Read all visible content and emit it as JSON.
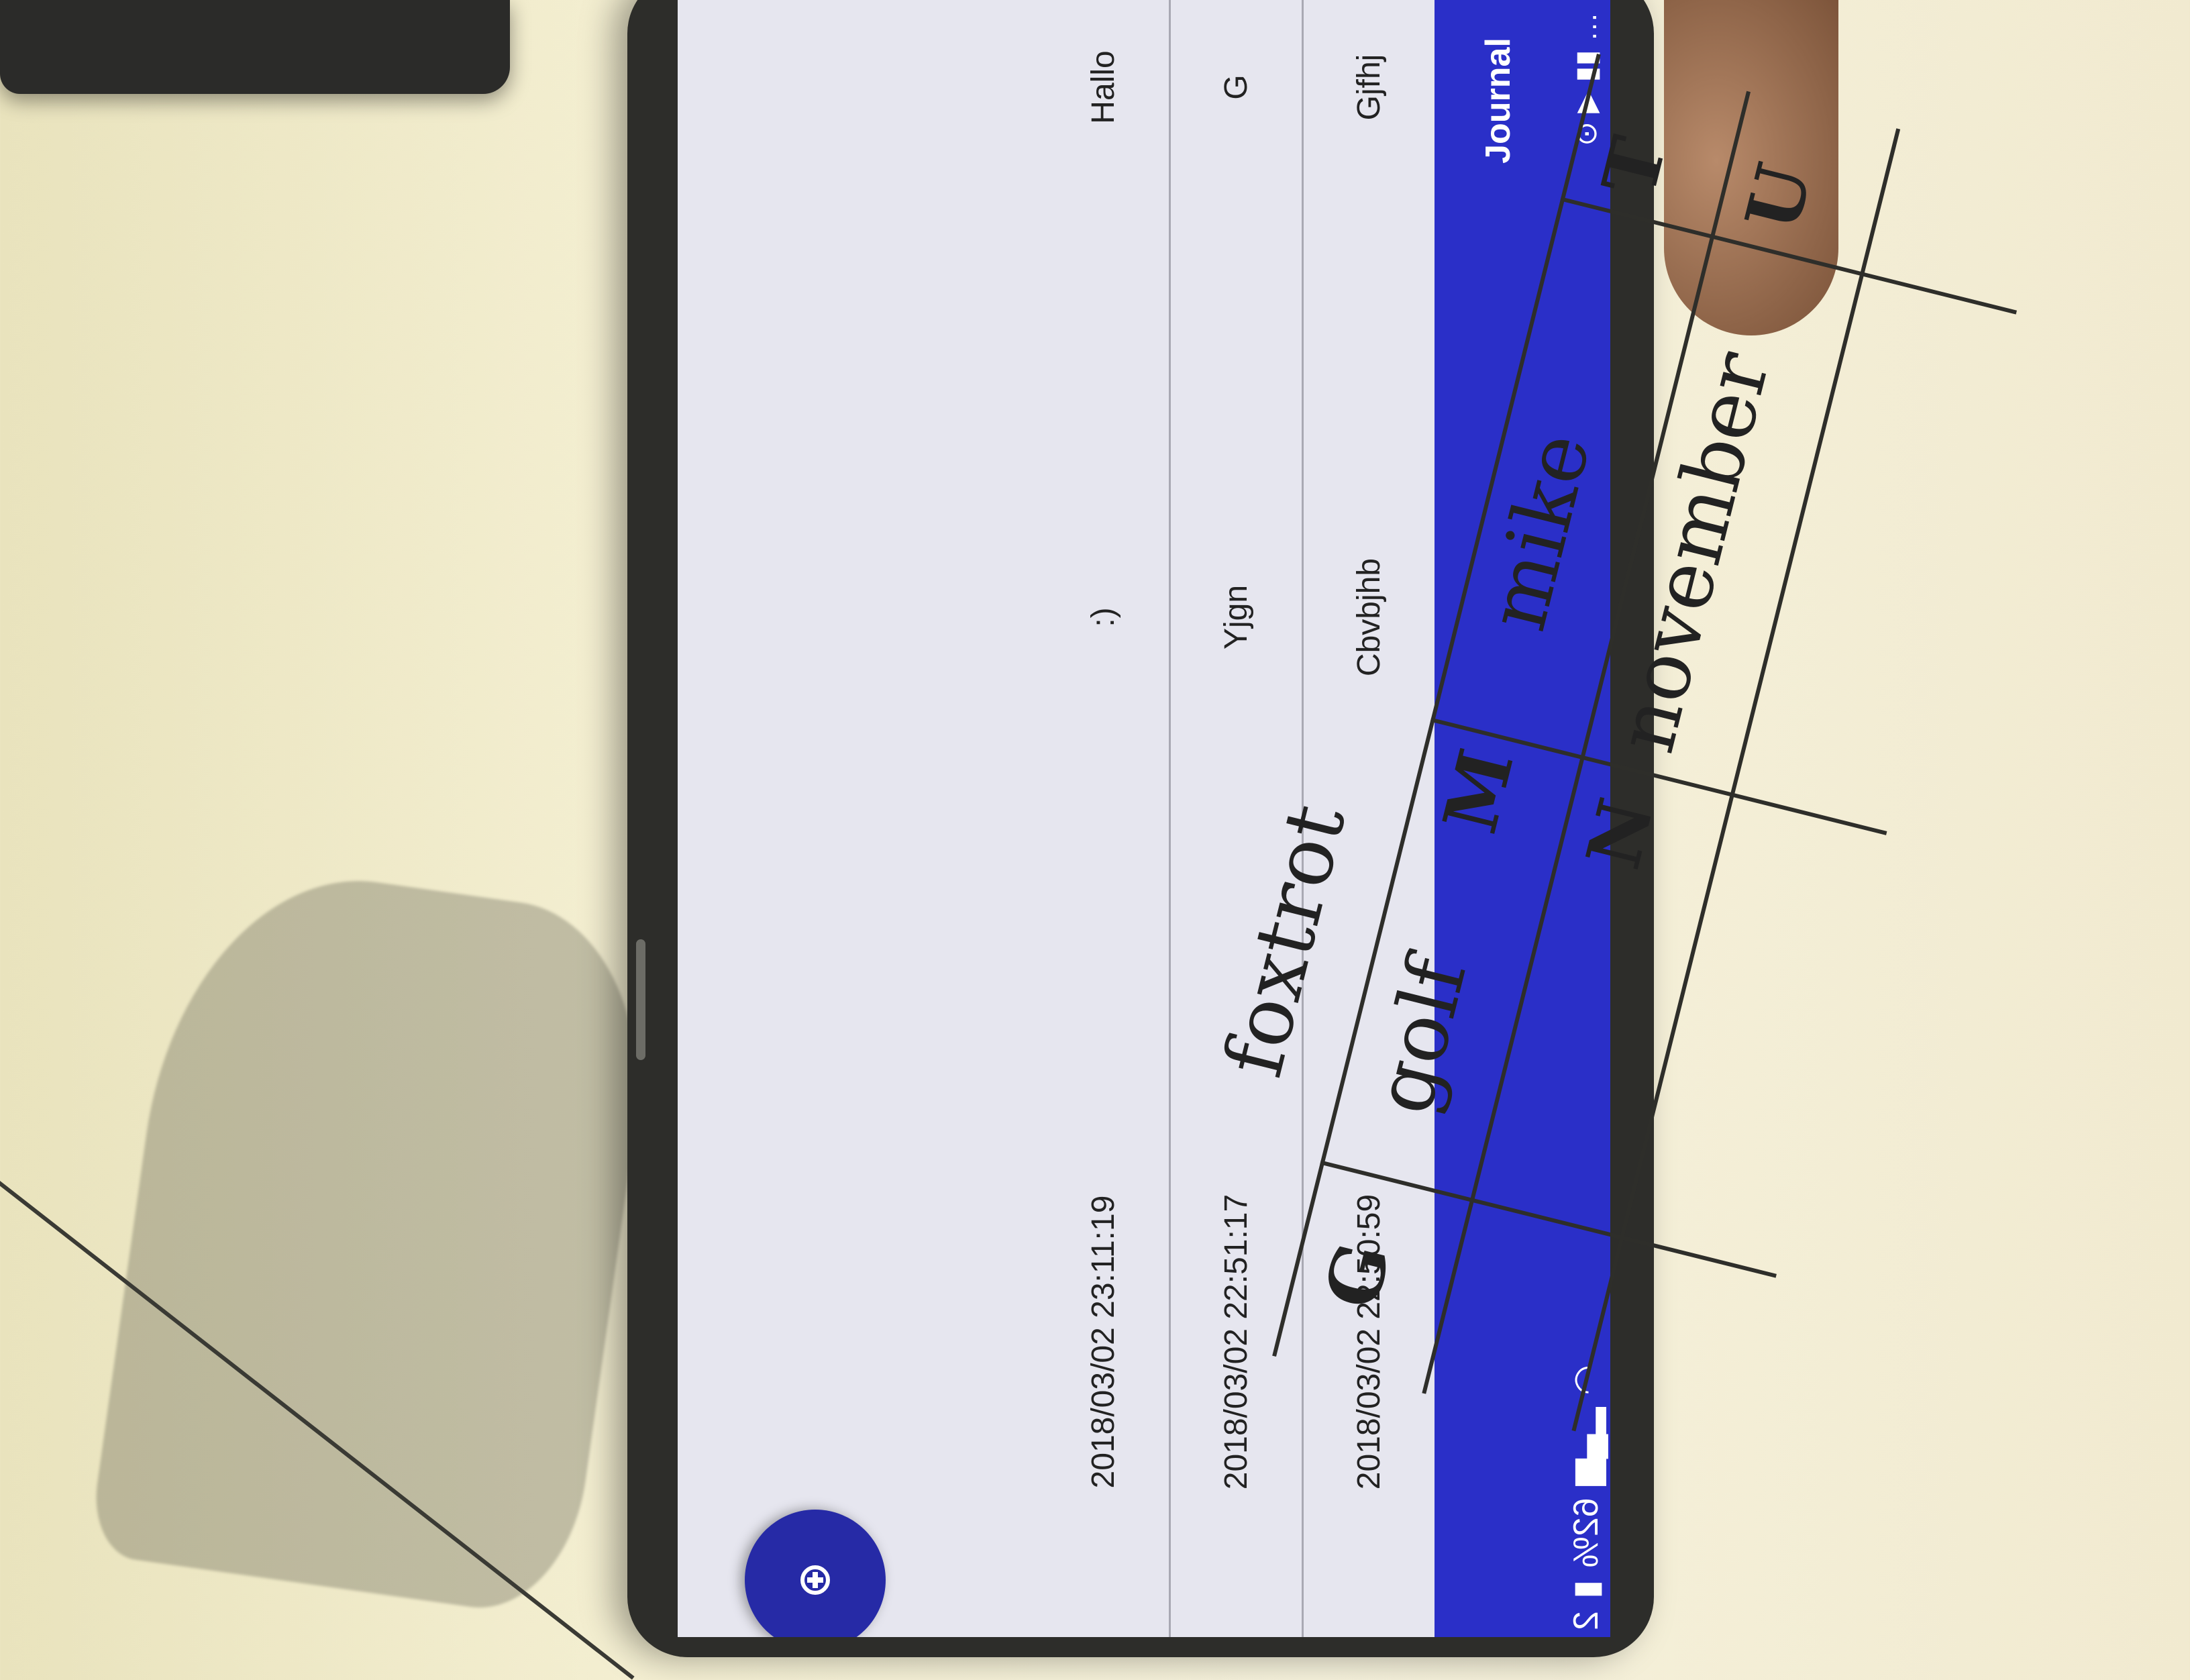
{
  "status_bar": {
    "battery": "62%",
    "time_partial": "2"
  },
  "app": {
    "title": "Journal",
    "entries": [
      {
        "title": "Gjfhj",
        "body": "Cbvbjhb",
        "date": "2018/03/02 22:50:59"
      },
      {
        "title": "G",
        "body": "Yjgn",
        "date": "2018/03/02 22:51:17"
      },
      {
        "title": "Hallo",
        "body": ":)",
        "date": "2018/03/02 23:11:19"
      }
    ],
    "fab_icon": "add-icon"
  },
  "paper": {
    "letters": [
      "G",
      "M",
      "N",
      "T",
      "U"
    ],
    "words": [
      "foxtrot",
      "golf",
      "mike",
      "november"
    ]
  },
  "colors": {
    "toolbar": "#2a2fc8",
    "fab": "#262aa6",
    "list_bg": "#e6e6ef"
  }
}
